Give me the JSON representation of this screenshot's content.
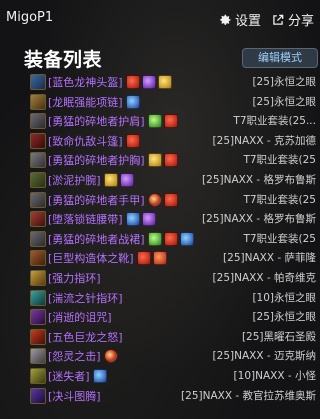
{
  "app": {
    "title": "MigoP1"
  },
  "toolbar": {
    "settings_label": "设置",
    "share_label": "分享",
    "settings_icon": "gear-icon",
    "share_icon": "share-icon"
  },
  "header": {
    "title": "装备列表",
    "edit_mode_label": "编辑模式"
  },
  "colors": {
    "epic": "#b470ff",
    "legendary": "#ff7d2a",
    "accent": "#9ed0ff"
  },
  "items": [
    {
      "name": "[蓝色龙神头盔]",
      "quality": "epic",
      "gems": [
        "red",
        "purple",
        "yellow"
      ],
      "source": "[25]永恒之眼"
    },
    {
      "name": "[龙眠强能项链]",
      "quality": "epic",
      "gems": [
        "blue"
      ],
      "source": "[25]永恒之眼"
    },
    {
      "name": "[勇猛的碎地者护肩]",
      "quality": "epic",
      "gems": [
        "green",
        "red"
      ],
      "source": "T7职业套装(25..."
    },
    {
      "name": "[致命仇敌斗篷]",
      "quality": "epic",
      "gems": [
        "red"
      ],
      "source": "[25]NAXX - 克苏加德"
    },
    {
      "name": "[勇猛的碎地者护胸]",
      "quality": "epic",
      "gems": [
        "yellow",
        "red"
      ],
      "source": "T7职业套装(25"
    },
    {
      "name": "[淤泥护腕]",
      "quality": "epic",
      "gems": [
        "yellow",
        "purple"
      ],
      "source": "[25]NAXX - 格罗布鲁斯"
    },
    {
      "name": "[勇猛的碎地者手甲]",
      "quality": "epic",
      "gems": [
        "orb",
        "red"
      ],
      "source": "T7职业套装(25"
    },
    {
      "name": "[堕落锁链腰带]",
      "quality": "epic",
      "gems": [
        "blue",
        "purple"
      ],
      "source": "[25]NAXX - 格罗布鲁斯"
    },
    {
      "name": "[勇猛的碎地者战裙]",
      "quality": "epic",
      "gems": [
        "green",
        "red",
        "blue"
      ],
      "source": "T7职业套装(25"
    },
    {
      "name": "[巨型构造体之靴]",
      "quality": "epic",
      "gems": [
        "red",
        "red2"
      ],
      "source": "[25]NAXX - 萨菲隆"
    },
    {
      "name": "[强力指环]",
      "quality": "epic",
      "gems": [],
      "source": "[25]NAXX - 帕奇维克"
    },
    {
      "name": "[湍流之针指环]",
      "quality": "epic",
      "gems": [],
      "source": "[10]永恒之眼"
    },
    {
      "name": "[消逝的诅咒]",
      "quality": "epic",
      "gems": [],
      "source": "[25]永恒之眼"
    },
    {
      "name": "[五色巨龙之怒]",
      "quality": "epic",
      "gems": [],
      "source": "[25]黑曜石圣殿"
    },
    {
      "name": "[怨灵之击]",
      "quality": "epic",
      "gems": [
        "orb"
      ],
      "source": "[25]NAXX - 迈克斯纳"
    },
    {
      "name": "[迷失者]",
      "quality": "epic",
      "gems": [
        "blue"
      ],
      "source": "[10]NAXX - 小怪"
    },
    {
      "name": "[决斗图腾]",
      "quality": "epic",
      "gems": [],
      "source": "[25]NAXX - 教官拉苏维奥斯"
    }
  ]
}
